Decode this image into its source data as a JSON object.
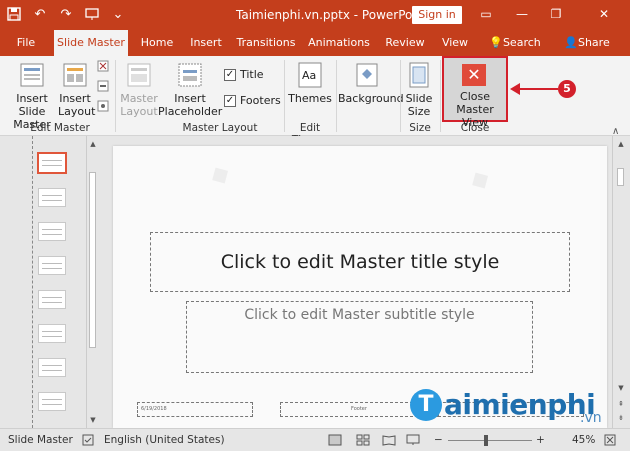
{
  "titlebar": {
    "title": "Taimienphi.vn.pptx - PowerPoint",
    "sign_in": "Sign in"
  },
  "tabs": [
    {
      "label": "File"
    },
    {
      "label": "Slide Master"
    },
    {
      "label": "Home"
    },
    {
      "label": "Insert"
    },
    {
      "label": "Transitions"
    },
    {
      "label": "Animations"
    },
    {
      "label": "Review"
    },
    {
      "label": "View"
    },
    {
      "label": "Search"
    },
    {
      "label": "Share"
    }
  ],
  "ribbon": {
    "insert_slide_master": "Insert Slide Master",
    "insert_layout": "Insert Layout",
    "edit_master_label": "Edit Master",
    "master_layout": "Master Layout",
    "insert_placeholder": "Insert Placeholder",
    "title_check": "Title",
    "footers_check": "Footers",
    "master_layout_group": "Master Layout",
    "themes": "Themes",
    "edit_theme_label": "Edit Theme",
    "background": "Background",
    "slide_size": "Slide Size",
    "size_label": "Size",
    "close_master_view": "Close Master View",
    "close_label": "Close"
  },
  "callout": {
    "number": "5"
  },
  "slide": {
    "title_placeholder": "Click to edit Master title style",
    "subtitle_placeholder": "Click to edit Master subtitle style",
    "date": "6/19/2018",
    "footer": "Footer"
  },
  "brand": {
    "logo_letter": "T",
    "name": "aimienphi",
    "suffix": ".vn"
  },
  "status": {
    "view": "Slide Master",
    "language": "English (United States)",
    "zoom": "45%"
  },
  "colors": {
    "accent": "#c43e1c",
    "highlight": "#d3202b"
  }
}
